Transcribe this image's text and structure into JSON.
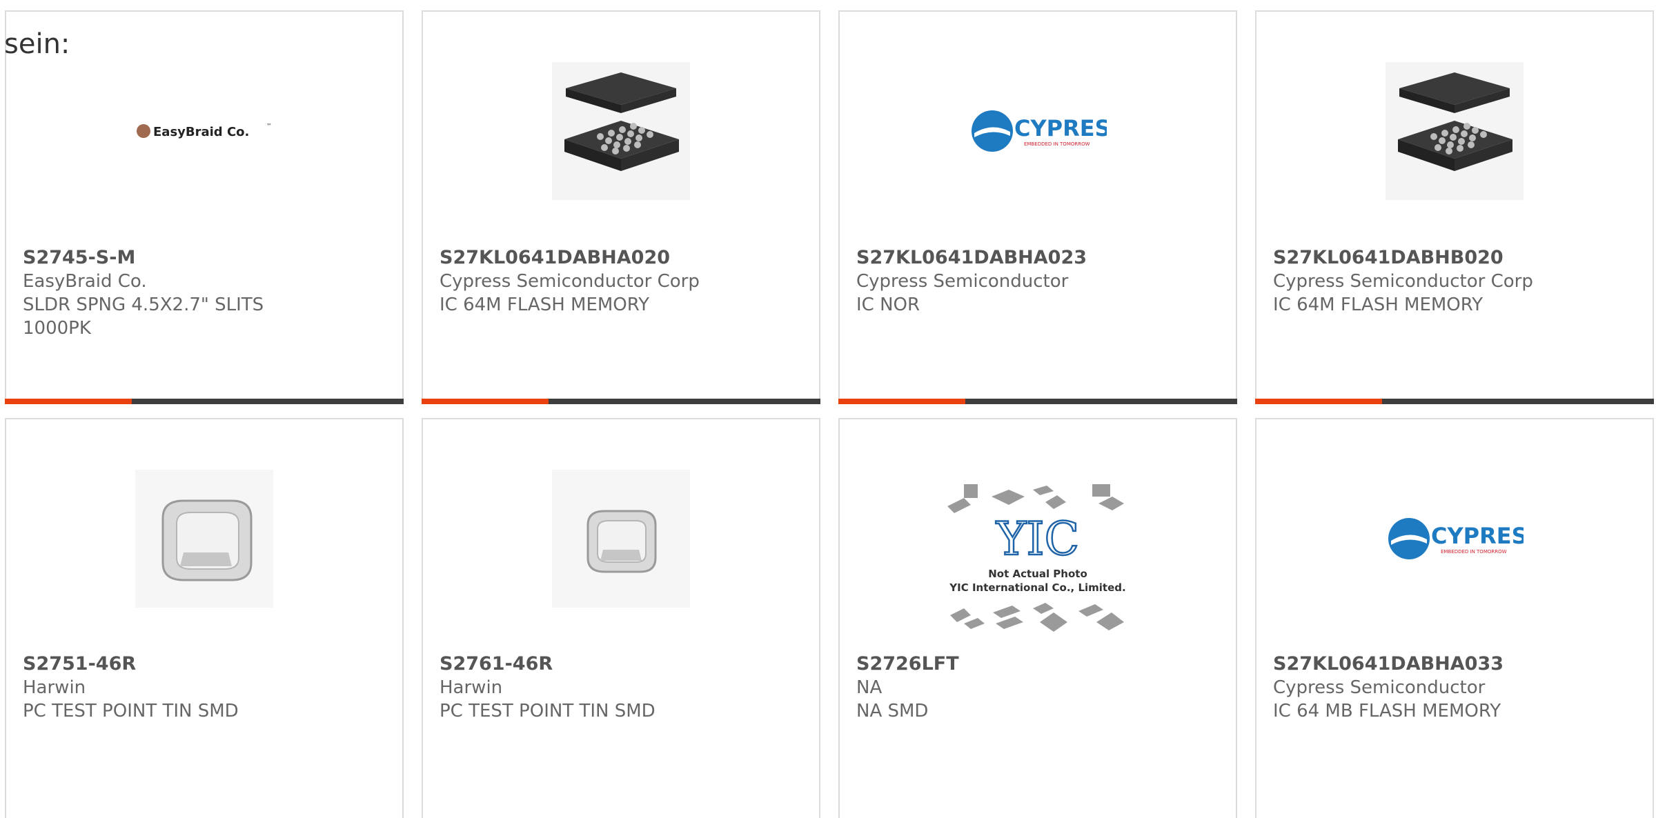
{
  "lead_text": "sein:",
  "products": [
    {
      "part_number": "S2745-S-M",
      "manufacturer": "EasyBraid Co.",
      "description": "SLDR SPNG 4.5X2.7\" SLITS",
      "description2": "1000PK",
      "image": "easybraid-logo"
    },
    {
      "part_number": "S27KL0641DABHA020",
      "manufacturer": "Cypress Semiconductor Corp",
      "description": "IC 64M FLASH MEMORY",
      "description2": "",
      "image": "bga-chip-photo"
    },
    {
      "part_number": "S27KL0641DABHA023",
      "manufacturer": "Cypress Semiconductor",
      "description": "IC NOR",
      "description2": "",
      "image": "cypress-logo"
    },
    {
      "part_number": "S27KL0641DABHB020",
      "manufacturer": "Cypress Semiconductor Corp",
      "description": "IC 64M FLASH MEMORY",
      "description2": "",
      "image": "bga-chip-photo"
    },
    {
      "part_number": "S2751-46R",
      "manufacturer": "Harwin",
      "description": "PC TEST POINT TIN SMD",
      "description2": "",
      "image": "test-point-photo"
    },
    {
      "part_number": "S2761-46R",
      "manufacturer": "Harwin",
      "description": "PC TEST POINT TIN SMD",
      "description2": "",
      "image": "test-point-photo"
    },
    {
      "part_number": "S2726LFT",
      "manufacturer": "NA",
      "description": "NA SMD",
      "description2": "",
      "image": "yic-placeholder"
    },
    {
      "part_number": "S27KL0641DABHA033",
      "manufacturer": "Cypress Semiconductor",
      "description": "IC 64 MB FLASH MEMORY",
      "description2": "",
      "image": "cypress-logo"
    }
  ],
  "logos": {
    "easybraid": "EasyBraid Co.",
    "easybraid_tm": "™",
    "cypress": "CYPRESS",
    "cypress_tagline": "EMBEDDED IN TOMORROW",
    "yic_mark": "YIC",
    "yic_line1": "Not Actual Photo",
    "yic_line2": "YIC International Co., Limited."
  },
  "colors": {
    "accent": "#e8410f",
    "bar": "#3d3d3d",
    "border": "#dcdcdc",
    "text": "#666666",
    "cypress_blue": "#1f7bc1",
    "cypress_red": "#d3202e"
  }
}
